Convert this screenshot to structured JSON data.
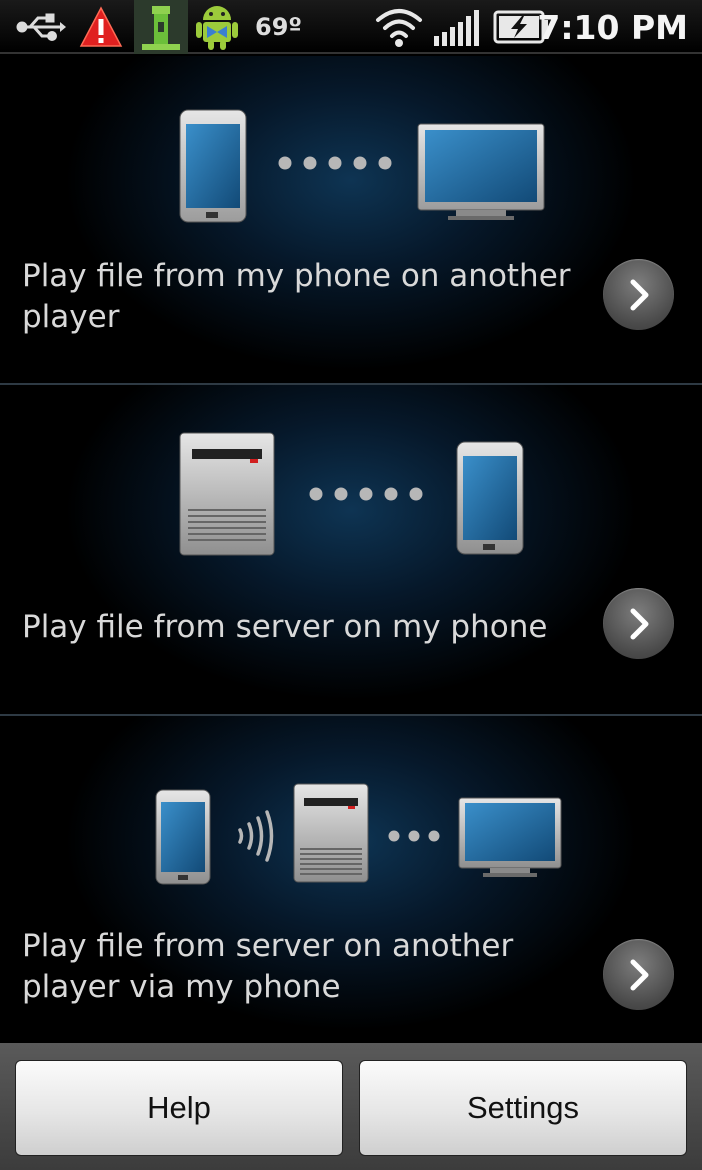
{
  "status_bar": {
    "temperature": "69º",
    "time": "7:10 PM",
    "icons": [
      "usb-icon",
      "warning-icon",
      "flashlight-icon",
      "android-icon",
      "wifi-icon",
      "signal-icon",
      "battery-charging-icon"
    ]
  },
  "options": [
    {
      "label": "Play file from my phone on another player"
    },
    {
      "label": "Play file from server on my phone"
    },
    {
      "label": "Play file from server on another player via my phone"
    }
  ],
  "bottom_bar": {
    "help_label": "Help",
    "settings_label": "Settings"
  },
  "colors": {
    "warning": "#e02020",
    "screen_blue": "#1f74b0",
    "server_led": "#d11f1f"
  }
}
